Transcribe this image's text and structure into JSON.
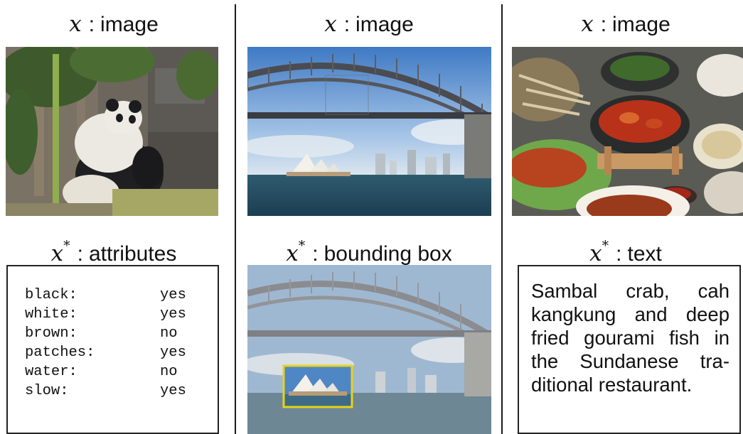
{
  "panels": [
    {
      "input_symbol": "x",
      "input_label": "image",
      "target_symbol": "x",
      "target_superscript": "*",
      "target_label": "attributes",
      "image_icon": "panda-photo-icon",
      "attributes": [
        {
          "name": "black:",
          "value": "yes"
        },
        {
          "name": "white:",
          "value": "yes"
        },
        {
          "name": "brown:",
          "value": "no"
        },
        {
          "name": "patches:",
          "value": "yes"
        },
        {
          "name": "water:",
          "value": "no"
        },
        {
          "name": "slow:",
          "value": "yes"
        }
      ]
    },
    {
      "input_symbol": "x",
      "input_label": "image",
      "target_symbol": "x",
      "target_superscript": "*",
      "target_label": "bounding box",
      "image_icon": "harbour-bridge-photo-icon",
      "box_color": "#e8d21a"
    },
    {
      "input_symbol": "x",
      "input_label": "image",
      "target_symbol": "x",
      "target_superscript": "*",
      "target_label": "text",
      "image_icon": "food-table-photo-icon",
      "caption": "Sambal crab, cah kangkung and deep fried gourami fish in the Sundanese tra-ditional restaurant."
    }
  ]
}
